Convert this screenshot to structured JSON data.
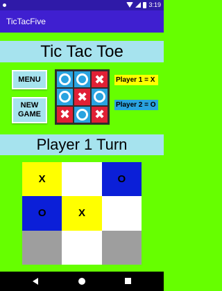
{
  "status_bar": {
    "time": "3:19"
  },
  "app_bar": {
    "title": "TicTacFive"
  },
  "title_banner": {
    "text": "Tic Tac Toe"
  },
  "buttons": {
    "menu": "MENU",
    "new_game": "NEW\nGAME"
  },
  "mini_board": {
    "cells": [
      {
        "mark": "O",
        "color": "#2aa3e0"
      },
      {
        "mark": "O",
        "color": "#2aa3e0"
      },
      {
        "mark": "X",
        "color": "#e02035"
      },
      {
        "mark": "O",
        "color": "#2aa3e0"
      },
      {
        "mark": "X",
        "color": "#e02035"
      },
      {
        "mark": "O",
        "color": "#2aa3e0"
      },
      {
        "mark": "X",
        "color": "#e02035"
      },
      {
        "mark": "O",
        "color": "#2aa3e0"
      },
      {
        "mark": "X",
        "color": "#e02035"
      }
    ]
  },
  "players": {
    "p1": "Player 1 = X",
    "p2": "Player 2 = O"
  },
  "turn_banner": {
    "text": "Player 1 Turn"
  },
  "board": {
    "cells": [
      {
        "mark": "X",
        "color": "yellow"
      },
      {
        "mark": "",
        "color": "white"
      },
      {
        "mark": "O",
        "color": "blue"
      },
      {
        "mark": "O",
        "color": "blue"
      },
      {
        "mark": "X",
        "color": "yellow"
      },
      {
        "mark": "",
        "color": "white"
      },
      {
        "mark": "",
        "color": "gray"
      },
      {
        "mark": "",
        "color": "white"
      },
      {
        "mark": "",
        "color": "gray"
      }
    ]
  },
  "colors": {
    "background": "#66ff00",
    "app_bar": "#3f1fd0",
    "banner": "#a6e3ee"
  }
}
